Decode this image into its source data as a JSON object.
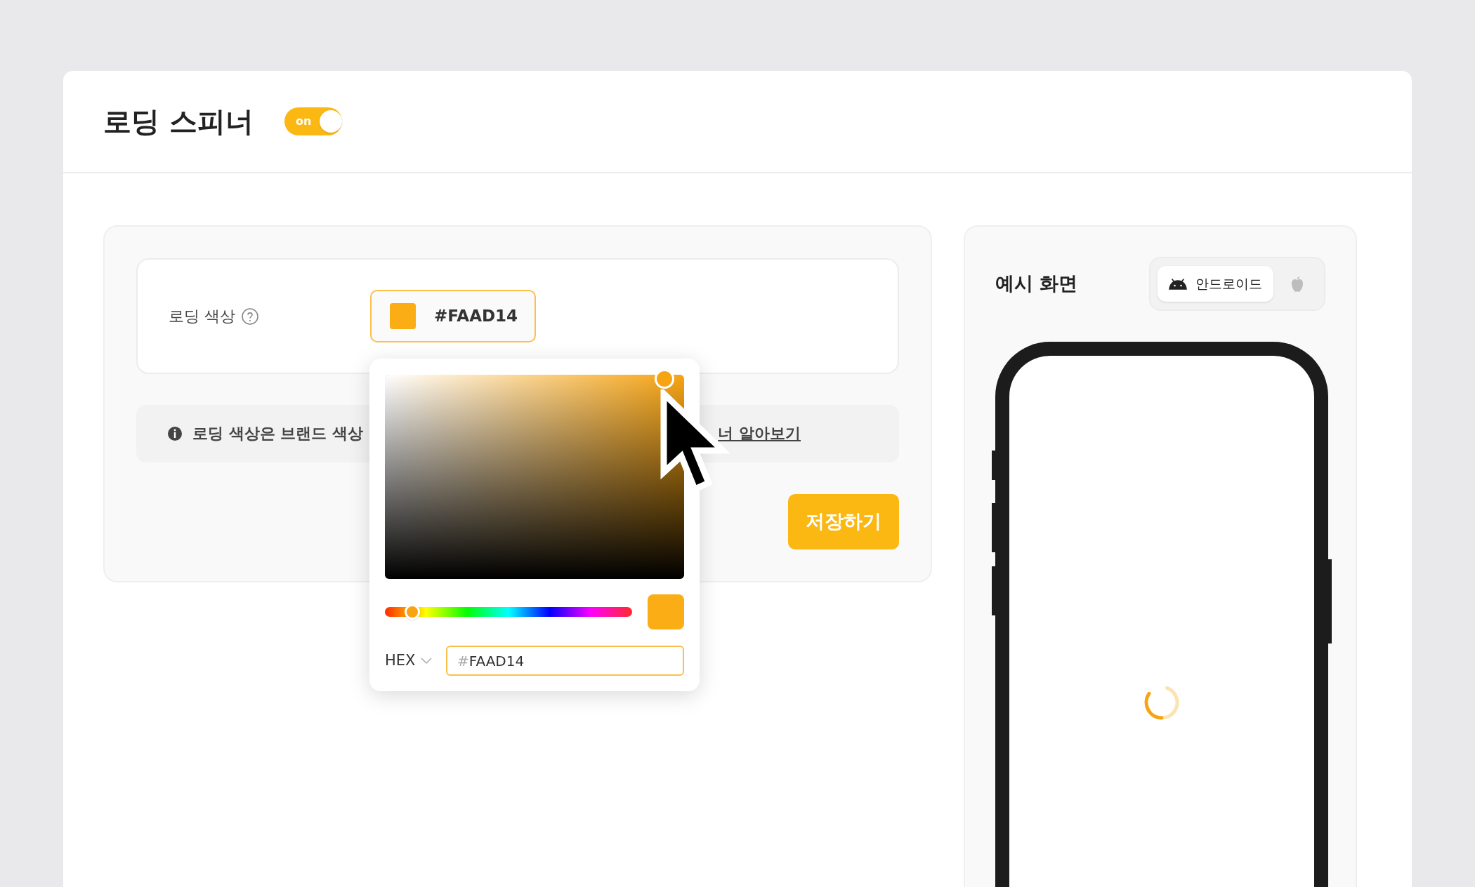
{
  "header": {
    "title": "로딩 스피너",
    "toggle": {
      "label": "on",
      "on": true
    }
  },
  "settings": {
    "color_label": "로딩 색상",
    "color_value": "#FAAD14",
    "info_text": "로딩 색상은 브랜드 색상",
    "info_link": "너 알아보기",
    "save_button": "저장하기"
  },
  "color_picker": {
    "hue_slider": {
      "level": 0.11
    },
    "mode": "HEX",
    "hex_prefix": "#",
    "hex_value": "FAAD14"
  },
  "preview": {
    "title": "예시 화면",
    "platforms": [
      {
        "kind": "android",
        "label": "안드로이드",
        "selected": true
      },
      {
        "kind": "ios",
        "selected": false
      }
    ]
  }
}
